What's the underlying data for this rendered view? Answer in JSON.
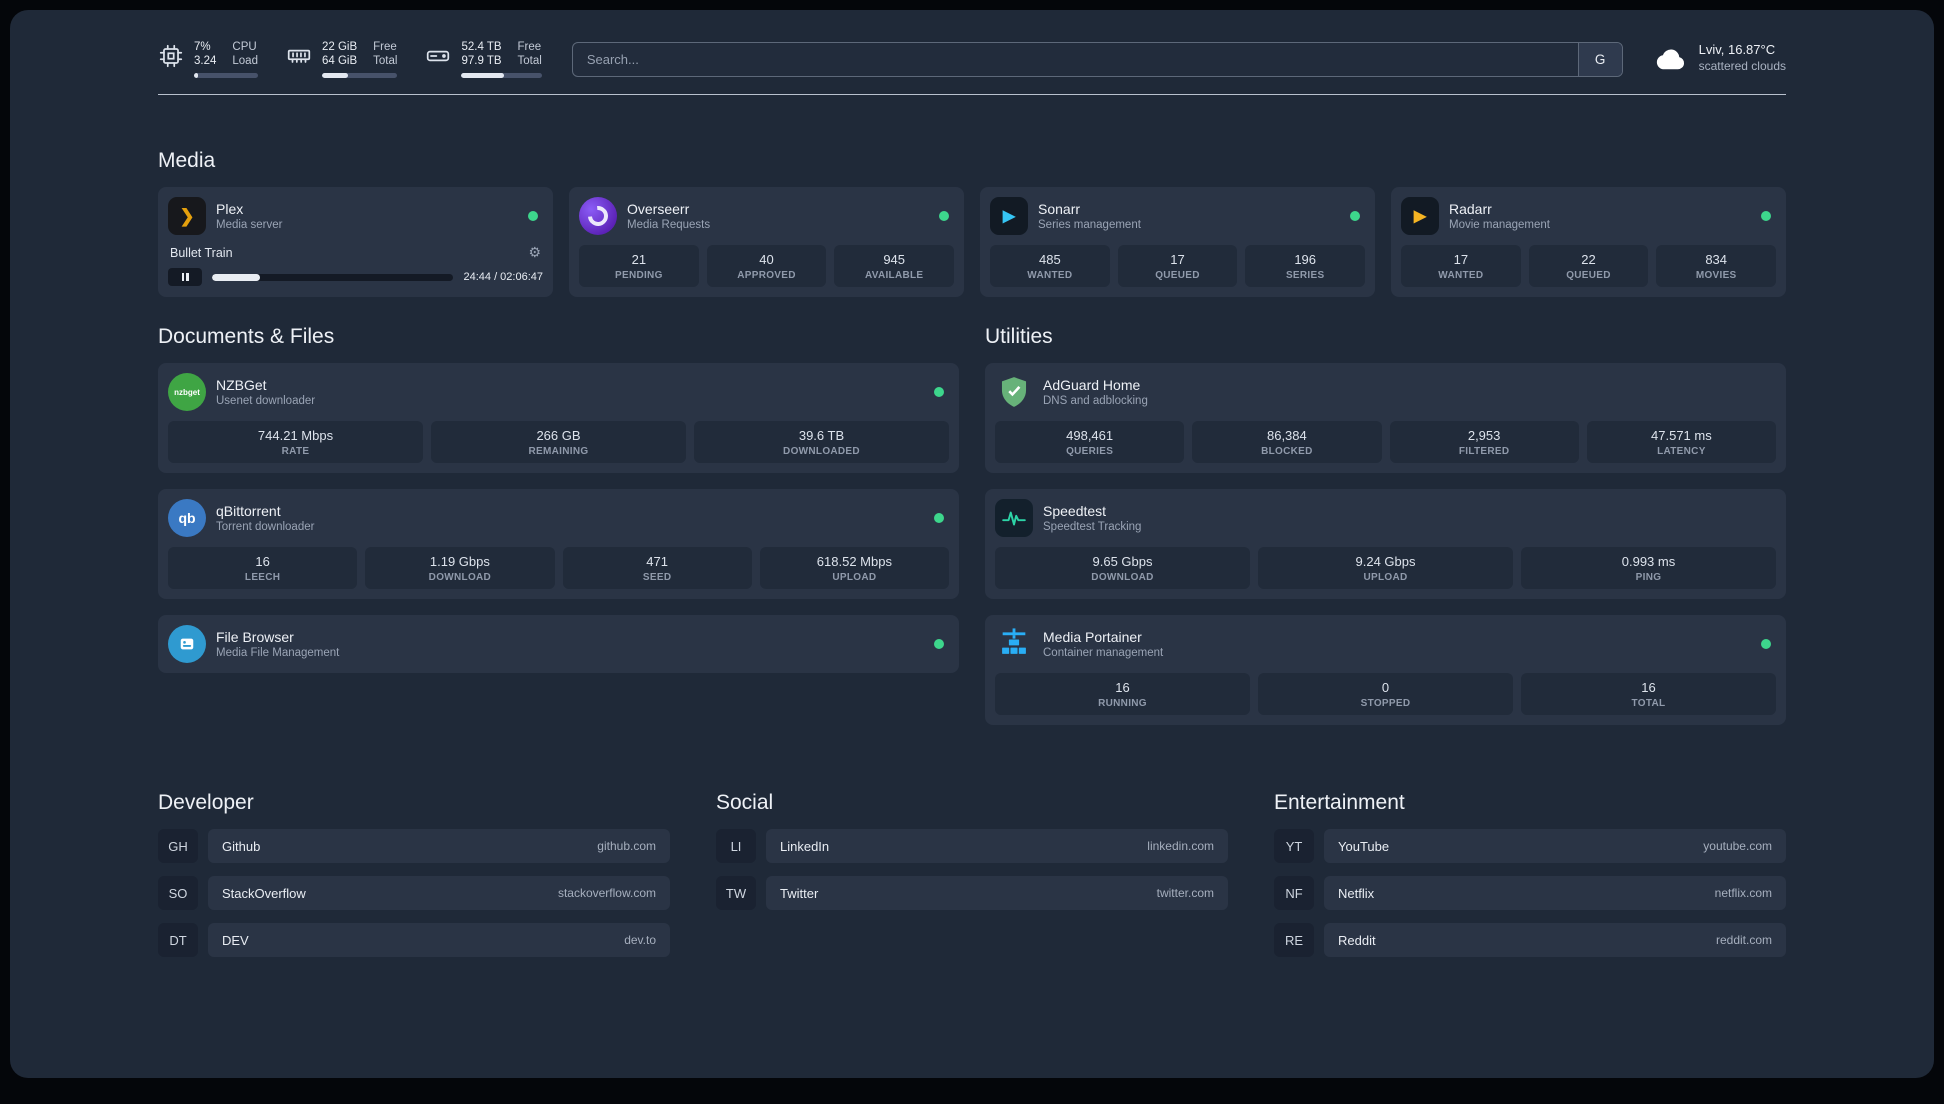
{
  "topbar": {
    "resources": [
      {
        "values": [
          "7%",
          "3.24"
        ],
        "labels": [
          "CPU",
          "Load"
        ],
        "progress": 7
      },
      {
        "values": [
          "22 GiB",
          "64 GiB"
        ],
        "labels": [
          "Free",
          "Total"
        ],
        "progress": 34
      },
      {
        "values": [
          "52.4 TB",
          "97.9 TB"
        ],
        "labels": [
          "Free",
          "Total"
        ],
        "progress": 53
      }
    ],
    "search": {
      "placeholder": "Search...",
      "provider_button": "G"
    },
    "weather": {
      "location": "Lviv, 16.87°C",
      "condition": "scattered clouds"
    }
  },
  "sections": {
    "media": {
      "title": "Media",
      "cards": [
        {
          "name": "Plex",
          "desc": "Media server",
          "status": "online",
          "player": {
            "track": "Bullet Train",
            "time": "24:44 / 02:06:47",
            "progress": 20
          }
        },
        {
          "name": "Overseerr",
          "desc": "Media Requests",
          "status": "online",
          "stats": [
            {
              "value": "21",
              "label": "PENDING"
            },
            {
              "value": "40",
              "label": "APPROVED"
            },
            {
              "value": "945",
              "label": "AVAILABLE"
            }
          ]
        },
        {
          "name": "Sonarr",
          "desc": "Series management",
          "status": "online",
          "stats": [
            {
              "value": "485",
              "label": "WANTED"
            },
            {
              "value": "17",
              "label": "QUEUED"
            },
            {
              "value": "196",
              "label": "SERIES"
            }
          ]
        },
        {
          "name": "Radarr",
          "desc": "Movie management",
          "status": "online",
          "stats": [
            {
              "value": "17",
              "label": "WANTED"
            },
            {
              "value": "22",
              "label": "QUEUED"
            },
            {
              "value": "834",
              "label": "MOVIES"
            }
          ]
        }
      ]
    },
    "documents": {
      "title": "Documents & Files",
      "cards": [
        {
          "name": "NZBGet",
          "desc": "Usenet downloader",
          "status": "online",
          "stats": [
            {
              "value": "744.21 Mbps",
              "label": "RATE"
            },
            {
              "value": "266 GB",
              "label": "REMAINING"
            },
            {
              "value": "39.6 TB",
              "label": "DOWNLOADED"
            }
          ]
        },
        {
          "name": "qBittorrent",
          "desc": "Torrent downloader",
          "status": "online",
          "stats": [
            {
              "value": "16",
              "label": "LEECH"
            },
            {
              "value": "1.19 Gbps",
              "label": "DOWNLOAD"
            },
            {
              "value": "471",
              "label": "SEED"
            },
            {
              "value": "618.52 Mbps",
              "label": "UPLOAD"
            }
          ]
        },
        {
          "name": "File Browser",
          "desc": "Media File Management",
          "status": "online",
          "stats": []
        }
      ]
    },
    "utilities": {
      "title": "Utilities",
      "cards": [
        {
          "name": "AdGuard Home",
          "desc": "DNS and adblocking",
          "stats": [
            {
              "value": "498,461",
              "label": "QUERIES"
            },
            {
              "value": "86,384",
              "label": "BLOCKED"
            },
            {
              "value": "2,953",
              "label": "FILTERED"
            },
            {
              "value": "47.571 ms",
              "label": "LATENCY"
            }
          ]
        },
        {
          "name": "Speedtest",
          "desc": "Speedtest Tracking",
          "stats": [
            {
              "value": "9.65 Gbps",
              "label": "DOWNLOAD"
            },
            {
              "value": "9.24 Gbps",
              "label": "UPLOAD"
            },
            {
              "value": "0.993 ms",
              "label": "PING"
            }
          ]
        },
        {
          "name": "Media Portainer",
          "desc": "Container management",
          "status": "online",
          "stats": [
            {
              "value": "16",
              "label": "RUNNING"
            },
            {
              "value": "0",
              "label": "STOPPED"
            },
            {
              "value": "16",
              "label": "TOTAL"
            }
          ]
        }
      ]
    }
  },
  "bookmarks": [
    {
      "title": "Developer",
      "items": [
        {
          "abbr": "GH",
          "name": "Github",
          "url": "github.com"
        },
        {
          "abbr": "SO",
          "name": "StackOverflow",
          "url": "stackoverflow.com"
        },
        {
          "abbr": "DT",
          "name": "DEV",
          "url": "dev.to"
        }
      ]
    },
    {
      "title": "Social",
      "items": [
        {
          "abbr": "LI",
          "name": "LinkedIn",
          "url": "linkedin.com"
        },
        {
          "abbr": "TW",
          "name": "Twitter",
          "url": "twitter.com"
        }
      ]
    },
    {
      "title": "Entertainment",
      "items": [
        {
          "abbr": "YT",
          "name": "YouTube",
          "url": "youtube.com"
        },
        {
          "abbr": "NF",
          "name": "Netflix",
          "url": "netflix.com"
        },
        {
          "abbr": "RE",
          "name": "Reddit",
          "url": "reddit.com"
        }
      ]
    }
  ],
  "icons": {
    "plex_glyph": "❯",
    "sonarr_glyph": "▶",
    "radarr_glyph": "▶",
    "gear_glyph": "⚙",
    "nzbget_label": "nzbget",
    "qbittorrent_label": "qb"
  }
}
